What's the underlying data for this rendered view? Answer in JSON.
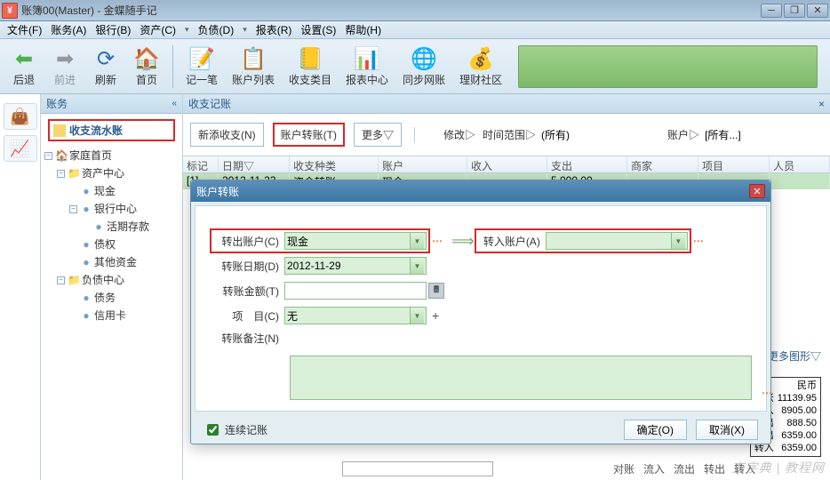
{
  "window": {
    "title": "账簿00(Master) - 金蝶随手记"
  },
  "menu": {
    "file": "文件(F)",
    "accounts": "账务(A)",
    "bank": "银行(B)",
    "assets": "资产(C)",
    "debts": "负债(D)",
    "reports": "报表(R)",
    "settings": "设置(S)",
    "help": "帮助(H)"
  },
  "toolbar": {
    "back": "后退",
    "fwd": "前进",
    "refresh": "刷新",
    "home": "首页",
    "newrec": "记一笔",
    "acclist": "账户列表",
    "cats": "收支类目",
    "rptcenter": "报表中心",
    "syncnet": "同步网账",
    "community": "理财社区"
  },
  "sidebar": {
    "head": "账务",
    "feature": "收支流水账",
    "items": {
      "home": "家庭首页",
      "asset_center": "资产中心",
      "cash": "现金",
      "bank_center": "银行中心",
      "demand": "活期存款",
      "credit_right": "债权",
      "other_asset": "其他资金",
      "debt_center": "负债中心",
      "debt": "债务",
      "credit_card": "信用卡"
    }
  },
  "tab": {
    "title": "收支记账",
    "close_hint": "×"
  },
  "buttons": {
    "newincexp": "新添收支(N)",
    "transfer": "账户转账(T)",
    "more": "更多▽",
    "edit": "修改▷",
    "range": "时间范围▷",
    "all1": "(所有)",
    "acc": "账户▷",
    "all2": "[所有...]"
  },
  "grid": {
    "cols": {
      "mark": "标记",
      "date": "日期",
      "cat": "收支种类",
      "acc": "账户",
      "income": "收入",
      "expense": "支出",
      "merchant": "商家",
      "project": "项目",
      "person": "人员"
    },
    "row1": {
      "mark": "[1]",
      "date": "2012-11-23",
      "cat": "资金转账",
      "acc": "现金",
      "income": "",
      "expense": "5,000.00"
    }
  },
  "dialog": {
    "title": "账户转账",
    "from_lbl": "转出账户(C)",
    "from_val": "现金",
    "to_lbl": "转入账户(A)",
    "to_val": "",
    "date_lbl": "转账日期(D)",
    "date_val": "2012-11-29",
    "amount_lbl": "转账金额(T)",
    "amount_val": "",
    "proj_lbl": "项　目(C)",
    "proj_val": "无",
    "note_lbl": "转账备注(N)",
    "continue": "连续记账",
    "ok": "确定(O)",
    "cancel": "取消(X)"
  },
  "summary": {
    "more": "更多图形▽",
    "currency": "民币",
    "duizhang": "对账",
    "duizhang_v": "11139.95",
    "liuru": "流入",
    "liuru_v": "8905.00",
    "liuchu": "流出",
    "liuchu_v": "888.50",
    "zhuanchu": "转出",
    "zhuanchu_v": "6359.00",
    "zhuanru": "转入",
    "zhuanru_v": "6359.00",
    "terms": {
      "t1": "对账",
      "t2": "流入",
      "t3": "流出",
      "t4": "转出",
      "t5": "转入"
    }
  },
  "watermark": "査字典 | 教程网"
}
